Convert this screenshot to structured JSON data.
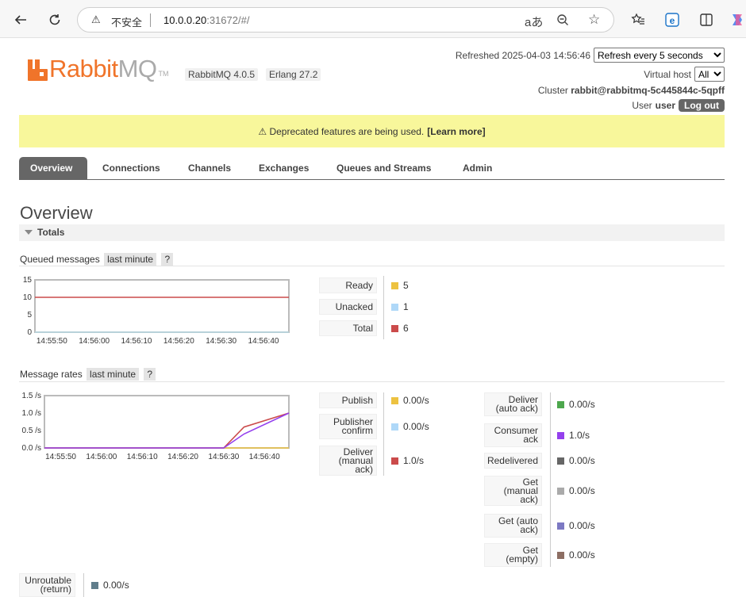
{
  "browser": {
    "insecure_label": "不安全",
    "url_host": "10.0.0.20",
    "url_rest": ":31672/#/",
    "icons": [
      "back-icon",
      "refresh-icon",
      "warning-icon",
      "read-aloud-icon",
      "zoom-icon",
      "favorite-star-icon",
      "favorites-icon",
      "edge-icon",
      "extensions-icon",
      "copilot-icon"
    ]
  },
  "app": {
    "logo_main": "Rabbit",
    "logo_suffix": "MQ",
    "logo_tm": "TM",
    "version": "RabbitMQ 4.0.5",
    "erlang": "Erlang 27.2"
  },
  "header": {
    "refreshed": "Refreshed 2025-04-03 14:56:46",
    "refresh_select": "Refresh every 5 seconds",
    "vhost_label": "Virtual host",
    "vhost_select": "All",
    "cluster_label": "Cluster",
    "cluster_name": "rabbit@rabbitmq-5c445844c-5qpff",
    "user_label": "User",
    "user_name": "user",
    "logout": "Log out"
  },
  "banner": {
    "text": "⚠ Deprecated features are being used.",
    "link": "[Learn more]"
  },
  "tabs": [
    "Overview",
    "Connections",
    "Channels",
    "Exchanges",
    "Queues and Streams",
    "Admin"
  ],
  "page_title": "Overview",
  "totals_label": "Totals",
  "queued": {
    "title": "Queued messages",
    "range": "last minute",
    "help": "?",
    "y_ticks": [
      "15",
      "10",
      "5",
      "0"
    ],
    "x_ticks": [
      "14:55:50",
      "14:56:00",
      "14:56:10",
      "14:56:20",
      "14:56:30",
      "14:56:40"
    ],
    "legend": [
      {
        "label": "Ready",
        "value": "5",
        "color": "#edc240"
      },
      {
        "label": "Unacked",
        "value": "1",
        "color": "#afd8f8"
      },
      {
        "label": "Total",
        "value": "6",
        "color": "#cb4b4b"
      }
    ]
  },
  "rates": {
    "title": "Message rates",
    "range": "last minute",
    "help": "?",
    "y_ticks": [
      "1.5 /s",
      "1.0 /s",
      "0.5 /s",
      "0.0 /s"
    ],
    "x_ticks": [
      "14:55:50",
      "14:56:00",
      "14:56:10",
      "14:56:20",
      "14:56:30",
      "14:56:40"
    ],
    "legend_left": [
      {
        "label": "Publish",
        "value": "0.00/s",
        "color": "#edc240"
      },
      {
        "label": "Publisher confirm",
        "value": "0.00/s",
        "color": "#afd8f8"
      },
      {
        "label": "Deliver (manual ack)",
        "value": "1.0/s",
        "color": "#cb4b4b"
      }
    ],
    "legend_right": [
      {
        "label": "Deliver (auto ack)",
        "value": "0.00/s",
        "color": "#4da74d"
      },
      {
        "label": "Consumer ack",
        "value": "1.0/s",
        "color": "#9440ed"
      },
      {
        "label": "Redelivered",
        "value": "0.00/s",
        "color": "#666666"
      },
      {
        "label": "Get (manual ack)",
        "value": "0.00/s",
        "color": "#aaaaaa"
      },
      {
        "label": "Get (auto ack)",
        "value": "0.00/s",
        "color": "#7c79c3"
      },
      {
        "label": "Get (empty)",
        "value": "0.00/s",
        "color": "#8d6e63"
      }
    ],
    "legend_bottom": [
      {
        "label": "Unroutable (return)",
        "value": "0.00/s",
        "color": "#607d8b"
      }
    ]
  },
  "chart_data": [
    {
      "type": "line",
      "title": "Queued messages",
      "x": [
        "14:55:46",
        "14:55:50",
        "14:56:00",
        "14:56:10",
        "14:56:20",
        "14:56:30",
        "14:56:40",
        "14:56:46"
      ],
      "series": [
        {
          "name": "Ready",
          "values": [
            0,
            0,
            0,
            0,
            0,
            0,
            0,
            0
          ]
        },
        {
          "name": "Unacked",
          "values": [
            0,
            0,
            0,
            0,
            0,
            0,
            0,
            0
          ]
        },
        {
          "name": "Total",
          "values": [
            10,
            10,
            10,
            10,
            10,
            10,
            10,
            10
          ]
        }
      ],
      "ylim": [
        0,
        15
      ],
      "grid": false
    },
    {
      "type": "line",
      "title": "Message rates",
      "x": [
        "14:55:46",
        "14:55:50",
        "14:56:00",
        "14:56:10",
        "14:56:20",
        "14:56:30",
        "14:56:35",
        "14:56:46"
      ],
      "series": [
        {
          "name": "Publish",
          "values": [
            0,
            0,
            0,
            0,
            0,
            0,
            0,
            0
          ]
        },
        {
          "name": "Deliver (manual ack)",
          "values": [
            0,
            0,
            0,
            0,
            0,
            0,
            0.6,
            1.0
          ]
        },
        {
          "name": "Consumer ack",
          "values": [
            0,
            0,
            0,
            0,
            0,
            0,
            0.4,
            1.0
          ]
        }
      ],
      "ylim": [
        0,
        1.5
      ],
      "grid": false
    }
  ]
}
